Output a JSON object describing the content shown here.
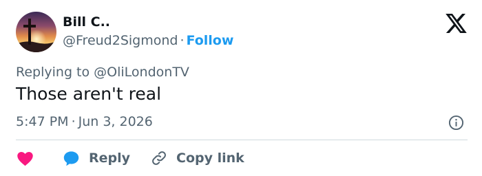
{
  "user": {
    "name": "Bill C..",
    "handle": "@Freud2Sigmond",
    "separator": "·",
    "follow_label": "Follow",
    "avatar_icon": "cross-sunset-avatar"
  },
  "header": {
    "logo_icon": "x-logo-icon"
  },
  "tweet": {
    "replying_to": "Replying to @OliLondonTV",
    "text": "Those aren't real",
    "time": "5:47 PM",
    "separator": "·",
    "date": "Jun 3, 2026"
  },
  "actions": {
    "like_icon": "heart-icon",
    "reply_icon": "speech-bubble-icon",
    "reply_label": "Reply",
    "copy_icon": "link-icon",
    "copy_label": "Copy link"
  },
  "colors": {
    "accent": "#1d9bf0",
    "like": "#f91880",
    "secondary_text": "#536471",
    "primary_text": "#0f1419",
    "divider": "#cfd9de"
  }
}
